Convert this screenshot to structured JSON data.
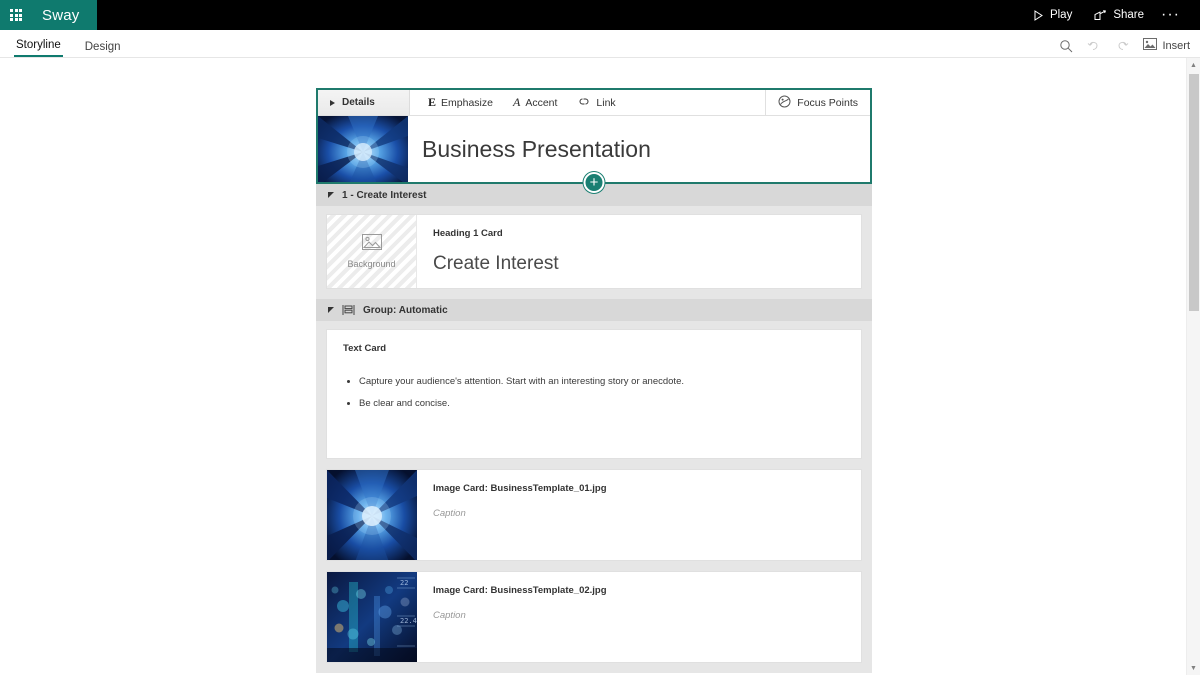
{
  "app": {
    "waffle_icon": "app-launcher-icon",
    "brand": "Sway"
  },
  "topbar": {
    "play": "Play",
    "share": "Share",
    "more": "···",
    "play_icon": "play-triangle-icon",
    "share_icon": "share-arrow-icon",
    "more_icon": "ellipsis-icon"
  },
  "ribbon": {
    "tabs": [
      {
        "label": "Storyline",
        "active": true
      },
      {
        "label": "Design",
        "active": false
      }
    ],
    "search_icon": "search-icon",
    "undo_icon": "undo-arrow-icon",
    "redo_icon": "redo-arrow-icon",
    "insert_icon": "insert-image-icon",
    "insert_label": "Insert"
  },
  "title_card": {
    "details_label": "Details",
    "details_icon": "expand-triangle-icon",
    "tools": [
      {
        "glyph": "E",
        "label": "Emphasize",
        "icon": "emphasize-icon"
      },
      {
        "glyph": "A",
        "label": "Accent",
        "icon": "accent-icon"
      },
      {
        "glyph": "link",
        "label": "Link",
        "icon": "link-chain-icon"
      }
    ],
    "focus_points_label": "Focus Points",
    "focus_points_icon": "focus-points-icon",
    "title": "Business Presentation",
    "thumbnail_icon": "title-background-thumbnail",
    "add_button_label": "+",
    "add_button_icon": "add-card-icon",
    "accent_color": "#1f7a6c"
  },
  "sections": [
    {
      "header": "1 - Create Interest",
      "header_icon": "collapse-triangle-icon",
      "cards": [
        {
          "type": "heading",
          "label": "Heading 1 Card",
          "background_placeholder": "Background",
          "background_icon": "image-placeholder-icon",
          "heading": "Create Interest"
        }
      ]
    },
    {
      "header": "Group: Automatic",
      "header_icon": "collapse-triangle-icon",
      "group_icon": "group-stack-icon",
      "cards": [
        {
          "type": "text",
          "label": "Text Card",
          "bullets": [
            "Capture your audience's attention.  Start with an interesting story or anecdote.",
            "Be clear and concise."
          ]
        },
        {
          "type": "image",
          "label": "Image Card: BusinessTemplate_01.jpg",
          "caption": "Caption",
          "thumbnail_icon": "business-template-01-thumbnail"
        },
        {
          "type": "image",
          "label": "Image Card: BusinessTemplate_02.jpg",
          "caption": "Caption",
          "thumbnail_icon": "business-template-02-thumbnail"
        }
      ]
    }
  ],
  "scrollbar": {
    "up_icon": "scroll-up-arrow-icon",
    "down_icon": "scroll-down-arrow-icon"
  },
  "colors": {
    "brand_teal": "#0f7a6e",
    "accent_teal": "#1f7a6c",
    "topbar_black": "#000000",
    "section_header": "#d8d8d8",
    "section_body": "#e6e6e6"
  }
}
